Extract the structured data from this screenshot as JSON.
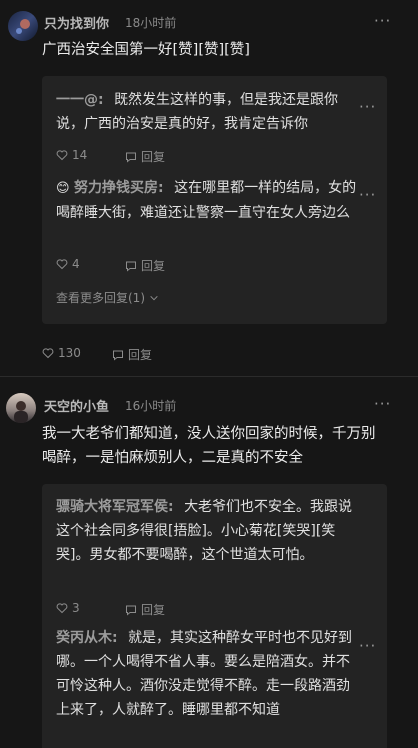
{
  "comments": [
    {
      "username": "只为找到你",
      "time": "18小时前",
      "content": "广西治安全国第一好[赞][赞][赞]",
      "likes": "130",
      "reply_label": "回复",
      "replies": [
        {
          "name": "一一@:",
          "text": "既然发生这样的事，但是我还是跟你说，广西的治安是真的好，我肯定告诉你",
          "likes": "14",
          "reply_label": "回复"
        },
        {
          "emoji": "😊",
          "name": "努力挣钱买房:",
          "text": "这在哪里都一样的结局，女的喝醉睡大街，难道还让警察一直守在女人旁边么",
          "likes": "4",
          "reply_label": "回复"
        }
      ],
      "more_replies": "查看更多回复(1)"
    },
    {
      "username": "天空的小鱼",
      "time": "16小时前",
      "content": "我一大老爷们都知道，没人送你回家的时候，千万别喝醉，一是怕麻烦别人，二是真的不安全",
      "replies": [
        {
          "name": "骠骑大将军冠军侯:",
          "text": "大老爷们也不安全。我跟说这个社会同多得很[捂脸]。小心菊花[笑哭][笑哭]。男女都不要喝醉，这个世道太可怕。",
          "likes": "3",
          "reply_label": "回复"
        },
        {
          "name": "癸丙从木:",
          "text": "就是，其实这种醉女平时也不见好到哪。一个人喝得不省人事。要么是陪酒女。并不可怜这种人。酒你没走觉得不醉。走一段路酒劲上来了，人就醉了。睡哪里都不知道"
        }
      ]
    }
  ],
  "more_icon": "ellipsis-icon",
  "like_icon": "heart-icon",
  "reply_icon": "comment-icon"
}
